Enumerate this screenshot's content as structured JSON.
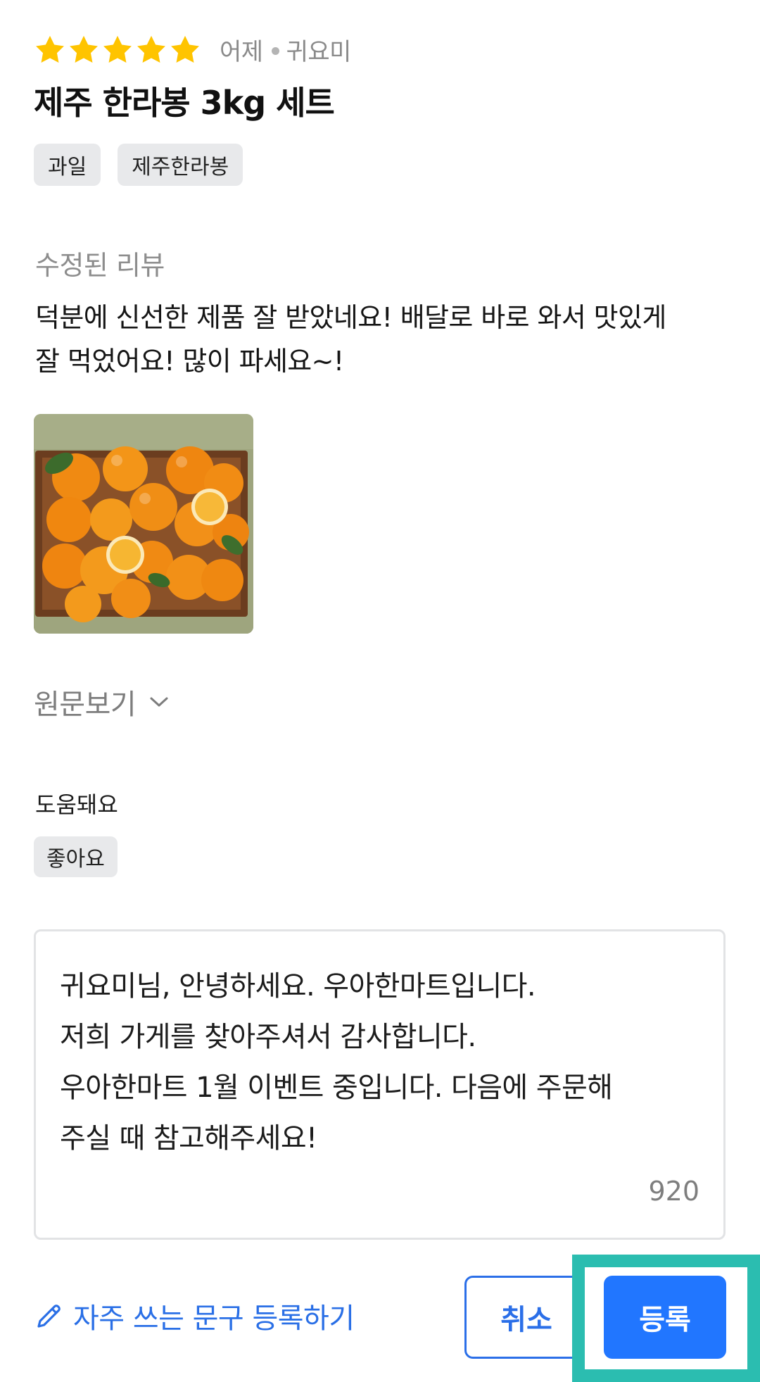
{
  "review": {
    "rating": 5,
    "date": "어제",
    "author": "귀요미",
    "product_title": "제주 한라봉 3kg 세트",
    "tags": [
      "과일",
      "제주한라봉"
    ],
    "section_label": "수정된 리뷰",
    "text": "덕분에 신선한 제품 잘 받았네요! 배달로 바로 와서 맛있게\n잘 먹었어요! 많이 파세요~!",
    "show_original_label": "원문보기"
  },
  "helpful": {
    "label": "도움돼요",
    "chip": "좋아요"
  },
  "reply": {
    "text": "귀요미님, 안녕하세요. 우아한마트입니다.\n저희 가게를 찾아주셔서 감사합니다.\n우아한마트 1월 이벤트 중입니다. 다음에 주문해\n주실 때 참고해주세요!",
    "char_count": "920"
  },
  "actions": {
    "phrase_link": "자주 쓰는 문구 등록하기",
    "cancel": "취소",
    "submit": "등록"
  },
  "colors": {
    "star": "#FFC400",
    "accent": "#2176FF",
    "highlight": "#2BBDB0"
  }
}
